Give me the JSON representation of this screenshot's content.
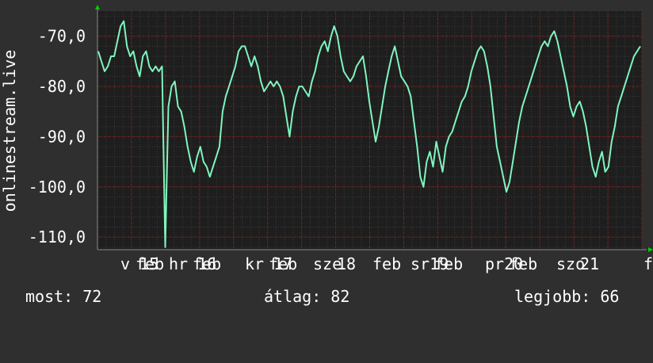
{
  "chart_data": {
    "type": "line",
    "ylabel": "onlinestream.live",
    "y_ticks": [
      "-70,0",
      "-80,0",
      "-90,0",
      "-100,0",
      "-110,0"
    ],
    "y_tick_values": [
      -70,
      -80,
      -90,
      -100,
      -110
    ],
    "ylim": [
      -112.5,
      -65
    ],
    "x_ticks": [
      "v 15",
      "feb",
      "hr 16",
      "feb",
      "kr 17",
      "feb",
      "sze",
      "18",
      "feb",
      "sr19",
      "feb",
      "pr20",
      "feb",
      "szo",
      "21",
      "f"
    ],
    "grid": true,
    "colors": {
      "line": "#7ff5c0",
      "grid": "#8b1a1a",
      "axis": "#00d000",
      "plot_bg": "#1e1e1e"
    },
    "series": [
      {
        "values": [
          -73,
          -75,
          -77,
          -76,
          -74,
          -74,
          -71,
          -68,
          -67,
          -72,
          -74,
          -73,
          -76,
          -78,
          -74,
          -73,
          -76,
          -77,
          -76,
          -77,
          -76,
          -112,
          -84,
          -80,
          -79,
          -84,
          -85,
          -88,
          -92,
          -95,
          -97,
          -94,
          -92,
          -95,
          -96,
          -98,
          -96,
          -94,
          -92,
          -85,
          -82,
          -80,
          -78,
          -76,
          -73,
          -72,
          -72,
          -74,
          -76,
          -74,
          -76,
          -79,
          -81,
          -80,
          -79,
          -80,
          -79,
          -80,
          -82,
          -86,
          -90,
          -85,
          -82,
          -80,
          -80,
          -81,
          -82,
          -79,
          -77,
          -74,
          -72,
          -71,
          -73,
          -70,
          -68,
          -70,
          -74,
          -77,
          -78,
          -79,
          -78,
          -76,
          -75,
          -74,
          -78,
          -83,
          -87,
          -91,
          -88,
          -84,
          -80,
          -77,
          -74,
          -72,
          -75,
          -78,
          -79,
          -80,
          -82,
          -87,
          -92,
          -98,
          -100,
          -95,
          -93,
          -96,
          -91,
          -94,
          -97,
          -92,
          -90,
          -89,
          -87,
          -85,
          -83,
          -82,
          -80,
          -77,
          -75,
          -73,
          -72,
          -73,
          -76,
          -80,
          -86,
          -92,
          -95,
          -98,
          -101,
          -99,
          -95,
          -91,
          -87,
          -84,
          -82,
          -80,
          -78,
          -76,
          -74,
          -72,
          -71,
          -72,
          -70,
          -69,
          -71,
          -74,
          -77,
          -80,
          -84,
          -86,
          -84,
          -83,
          -85,
          -88,
          -92,
          -96,
          -98,
          -95,
          -93,
          -97,
          -96,
          -91,
          -88,
          -84,
          -82,
          -80,
          -78,
          -76,
          -74,
          -73,
          -72
        ]
      }
    ]
  },
  "stats": {
    "current": "most: 72",
    "average": "átlag: 82",
    "best": "legjobb: 66"
  }
}
